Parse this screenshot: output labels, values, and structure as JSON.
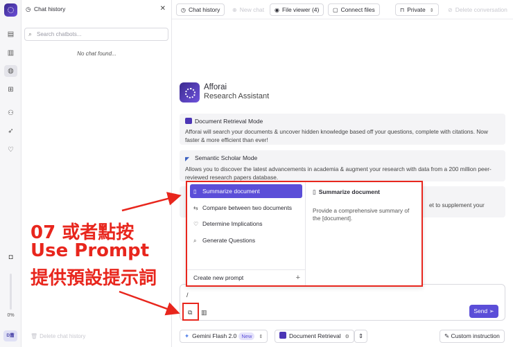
{
  "rail": {
    "icons": [
      "logo-icon",
      "document-icon",
      "library-icon",
      "chat-icon",
      "grid-icon",
      "users-icon",
      "rocket-icon",
      "bulb-icon"
    ],
    "camera_icon": "camera-icon",
    "usage_percent": "0%",
    "avatar_initials": "D蕭"
  },
  "history": {
    "title": "Chat history",
    "search_placeholder": "Search chatbots...",
    "empty_text": "No chat found...",
    "delete_label": "Delete chat history"
  },
  "toolbar": {
    "chat_history": "Chat history",
    "new_chat": "New chat",
    "file_viewer": "File viewer (4)",
    "connect_files": "Connect files",
    "visibility": "Private",
    "delete_conversation": "Delete conversation"
  },
  "brand": {
    "name": "Afforai",
    "subtitle": "Research Assistant"
  },
  "modes": [
    {
      "title": "Document Retrieval Mode",
      "description": "Afforai will search your documents & uncover hidden knowledge based off your questions, complete with citations. Now faster & more efficient than ever!"
    },
    {
      "title": "Semantic Scholar Mode",
      "description": "Allows you to discover the latest advancements in academia & augment your research with data from a 200 million peer-reviewed research papers database."
    },
    {
      "visible_tail": "et to supplement your"
    }
  ],
  "prompt_menu": {
    "items": [
      {
        "label": "Summarize document",
        "icon": "book-icon",
        "selected": true
      },
      {
        "label": "Compare between two documents",
        "icon": "compare-icon",
        "selected": false
      },
      {
        "label": "Determine Implications",
        "icon": "bulb-icon",
        "selected": false
      },
      {
        "label": "Generate Questions",
        "icon": "question-search-icon",
        "selected": false
      }
    ],
    "create_new": "Create new prompt",
    "detail_title": "Summarize document",
    "detail_description": "Provide a comprehensive summary of the [document]."
  },
  "input": {
    "value": "/",
    "send_label": "Send"
  },
  "bottom": {
    "model": "Gemini Flash 2.0",
    "model_badge": "New",
    "mode": "Document Retrieval",
    "custom_instruction": "Custom instruction"
  },
  "annotation": {
    "line1": "07 或者點按",
    "line2": "Use Prompt",
    "line3": "提供預設提示詞",
    "color": "#e8261d"
  },
  "colors": {
    "accent": "#5b4ed8",
    "brand": "#4b35b5",
    "annotation_red": "#e8261d"
  }
}
